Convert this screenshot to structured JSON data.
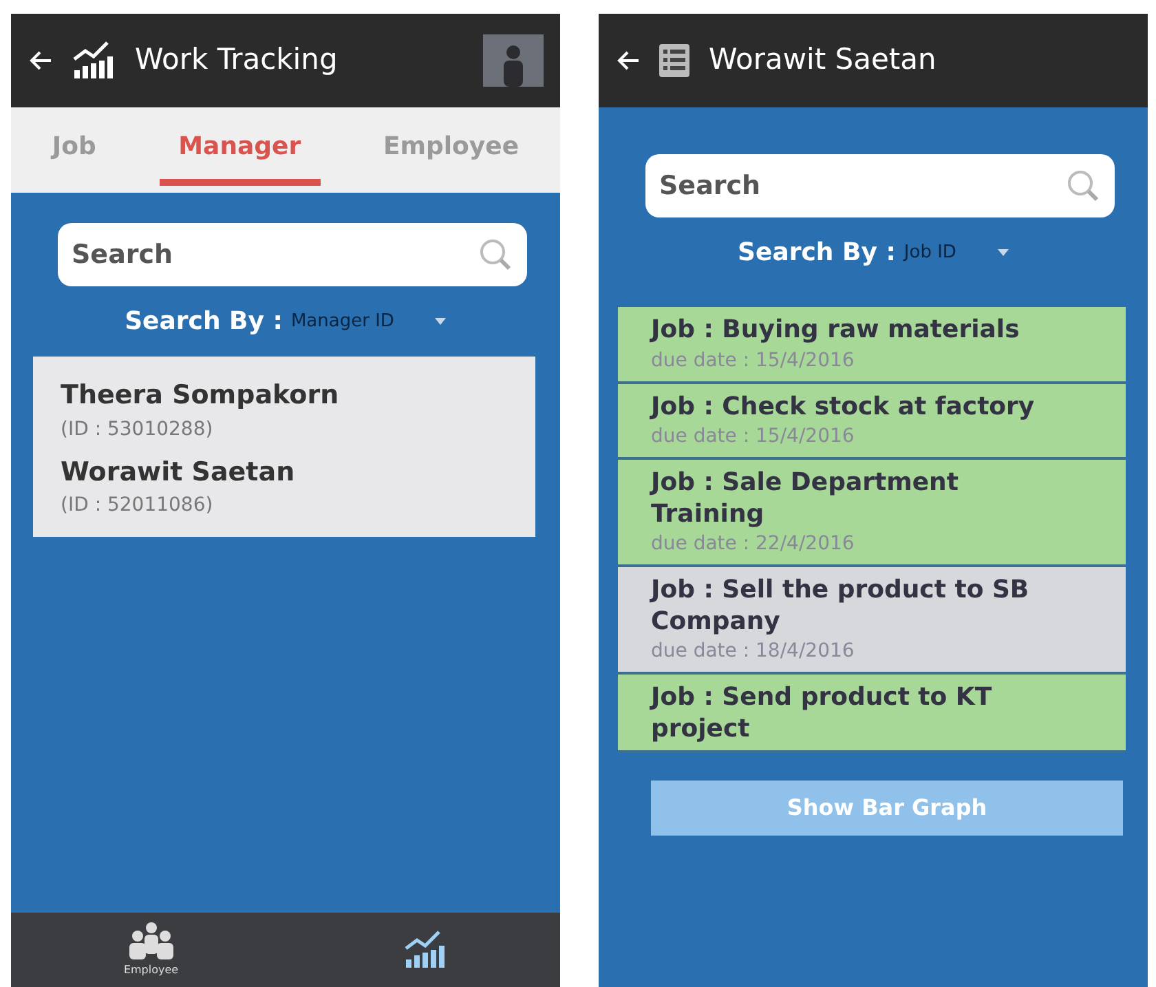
{
  "screens": [
    {
      "kind": "manager",
      "header": {
        "title": "Work Tracking"
      },
      "tabs": [
        {
          "label": "Job",
          "selected": false
        },
        {
          "label": "Manager",
          "selected": true
        },
        {
          "label": "Employee",
          "selected": false
        }
      ],
      "search": {
        "placeholder": "Search"
      },
      "search_by": {
        "label": "Search By :",
        "value": "Manager ID"
      },
      "people": [
        {
          "name": "Theera  Sompakorn",
          "id": "(ID : 53010288)"
        },
        {
          "name": "Worawit  Saetan",
          "id": "(ID : 52011086)"
        }
      ],
      "bottom_nav": [
        {
          "kind": "people",
          "label": "Employee",
          "selected": false
        },
        {
          "kind": "chart",
          "selected": true
        }
      ]
    },
    {
      "kind": "jobs",
      "header": {
        "title": "Worawit  Saetan"
      },
      "search": {
        "placeholder": "Search"
      },
      "search_by": {
        "label": "Search By :",
        "value": "Job ID"
      },
      "jobs": [
        {
          "title": "Job : Buying raw materials",
          "due": "due date : 15/4/2016",
          "color": "#a8d898"
        },
        {
          "title": "Job : Check stock at factory",
          "due": "due date : 15/4/2016",
          "color": "#a8d898"
        },
        {
          "title": "Job : Sale Department Training",
          "due": "due date : 22/4/2016",
          "color": "#a8d898"
        },
        {
          "title": "Job : Sell the product to SB Company",
          "due": "due date : 18/4/2016",
          "color": "#d6d8dc"
        },
        {
          "title": "Job : Send product to KT project",
          "color": "#a8d898"
        }
      ],
      "button": "Show Bar Graph"
    }
  ]
}
